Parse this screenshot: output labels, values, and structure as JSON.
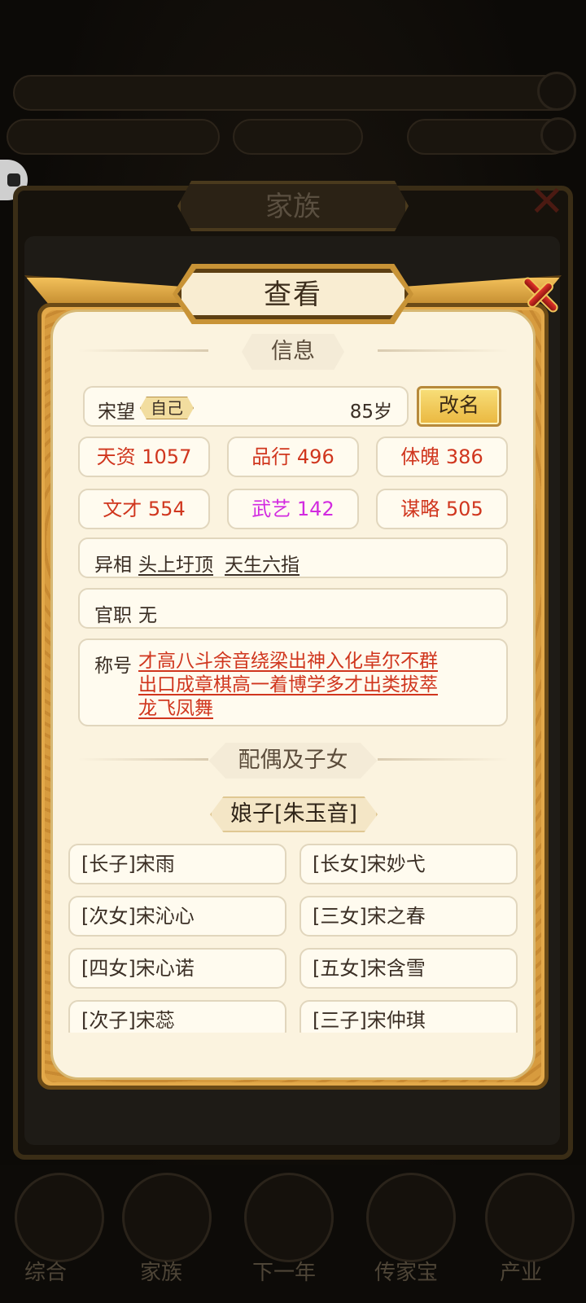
{
  "family_panel": {
    "title": "家族"
  },
  "bottom_nav": [
    "综合",
    "家族",
    "下一年",
    "传家宝",
    "产业"
  ],
  "dialog": {
    "title": "查看",
    "info_header": "信息",
    "person": {
      "name": "宋望",
      "badge": "自己",
      "age": "85岁"
    },
    "rename_label": "改名",
    "stats": [
      {
        "label": "天资 1057",
        "color": "#d0361e"
      },
      {
        "label": "品行 496",
        "color": "#d0361e"
      },
      {
        "label": "体魄 386",
        "color": "#d0361e"
      },
      {
        "label": "文才 554",
        "color": "#d0361e"
      },
      {
        "label": "武艺 142",
        "color": "#d22ae0"
      },
      {
        "label": "谋略 505",
        "color": "#d0361e"
      }
    ],
    "traits_label": "异相",
    "traits": [
      "头上圩顶",
      "天生六指"
    ],
    "office_label": "官职",
    "office_value": "无",
    "titles_label": "称号",
    "titles_line1": "才高八斗余音绕梁出神入化卓尔不群",
    "titles_line2": "出口成章棋高一着博学多才出类拔萃",
    "titles_line3": "龙飞凤舞",
    "family_header": "配偶及子女",
    "spouse": "娘子[朱玉音]",
    "children": [
      "[长子]宋雨",
      "[长女]宋妙弋",
      "[次女]宋沁心",
      "[三女]宋之春",
      "[四女]宋心诺",
      "[五女]宋含雪",
      "[次子]宋蕊",
      "[三子]宋仲琪"
    ]
  }
}
